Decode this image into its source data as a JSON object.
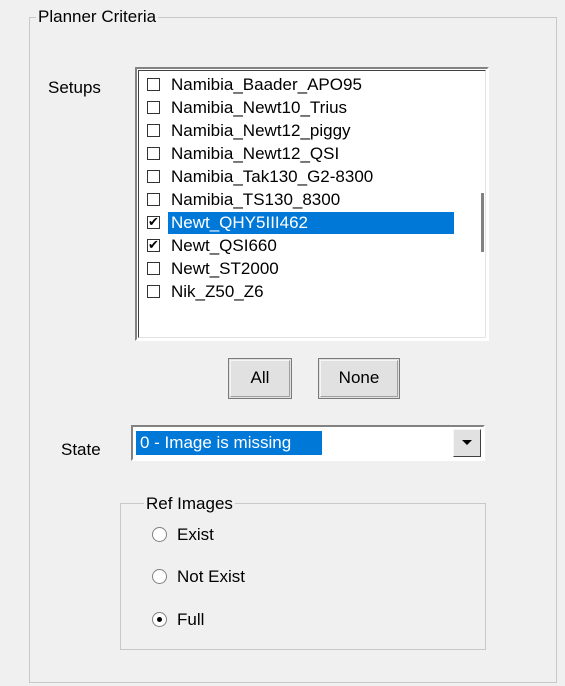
{
  "planner": {
    "title": "Planner Criteria",
    "setups_label": "Setups",
    "setups": [
      {
        "label": "Namibia_Baader_APO95",
        "checked": false,
        "selected": false
      },
      {
        "label": "Namibia_Newt10_Trius",
        "checked": false,
        "selected": false
      },
      {
        "label": "Namibia_Newt12_piggy",
        "checked": false,
        "selected": false
      },
      {
        "label": "Namibia_Newt12_QSI",
        "checked": false,
        "selected": false
      },
      {
        "label": "Namibia_Tak130_G2-8300",
        "checked": false,
        "selected": false
      },
      {
        "label": "Namibia_TS130_8300",
        "checked": false,
        "selected": false
      },
      {
        "label": "Newt_QHY5III462",
        "checked": true,
        "selected": true
      },
      {
        "label": "Newt_QSI660",
        "checked": true,
        "selected": false
      },
      {
        "label": "Newt_ST2000",
        "checked": false,
        "selected": false
      },
      {
        "label": "Nik_Z50_Z6",
        "checked": false,
        "selected": false
      }
    ],
    "all_button": "All",
    "none_button": "None",
    "state_label": "State",
    "state_value": "0 - Image is missing",
    "ref_images": {
      "title": "Ref Images",
      "options": [
        {
          "label": "Exist",
          "selected": false
        },
        {
          "label": "Not Exist",
          "selected": false
        },
        {
          "label": "Full",
          "selected": true
        }
      ]
    }
  }
}
